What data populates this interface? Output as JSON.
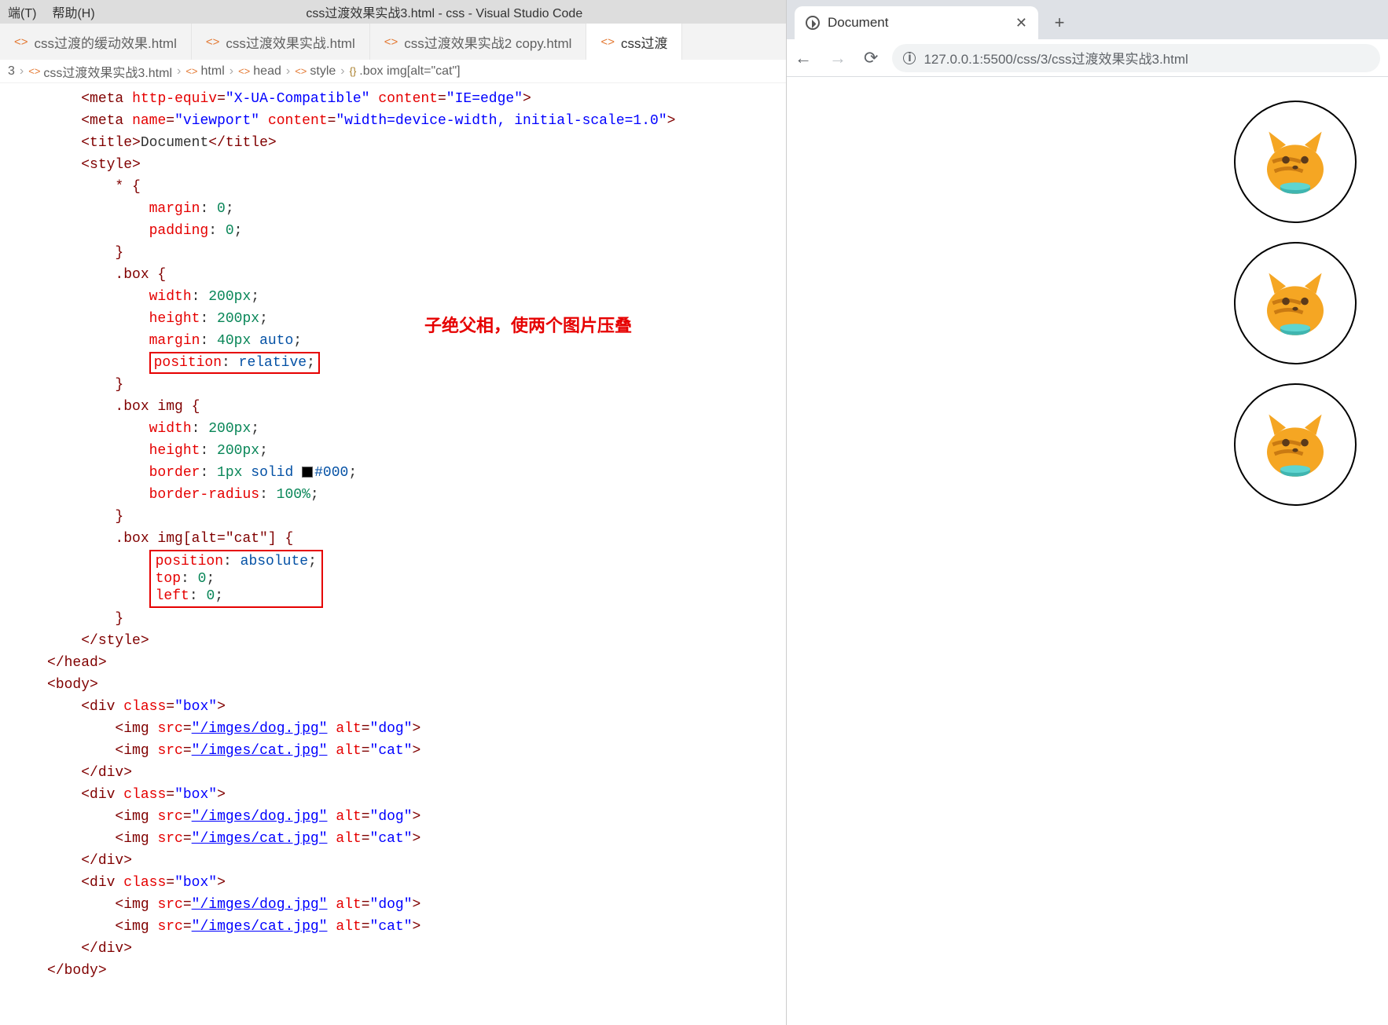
{
  "vscode": {
    "menubar": {
      "items": [
        "端(T)",
        "帮助(H)"
      ]
    },
    "title": "css过渡效果实战3.html - css - Visual Studio Code",
    "tabs": [
      {
        "label": "css过渡的缓动效果.html",
        "active": false
      },
      {
        "label": "css过渡效果实战.html",
        "active": false
      },
      {
        "label": "css过渡效果实战2 copy.html",
        "active": false
      },
      {
        "label": "css过渡",
        "active": true
      }
    ],
    "breadcrumb": [
      "3",
      "css过渡效果实战3.html",
      "html",
      "head",
      "style",
      ".box img[alt=\"cat\"]"
    ],
    "annotation": "子绝父相，使两个图片压叠",
    "code": {
      "meta1": {
        "tag": "meta",
        "a1": "http-equiv",
        "v1": "\"X-UA-Compatible\"",
        "a2": "content",
        "v2": "\"IE=edge\""
      },
      "meta2": {
        "tag": "meta",
        "a1": "name",
        "v1": "\"viewport\"",
        "a2": "content",
        "v2": "\"width=device-width, initial-scale=1.0\""
      },
      "title": {
        "open": "title",
        "text": "Document"
      },
      "style_open": "style",
      "r_star": {
        "sel": "* {",
        "p1": "margin",
        "v1": "0",
        "p2": "padding",
        "v2": "0",
        "close": "}"
      },
      "r_box": {
        "sel": ".box {",
        "p1": "width",
        "v1": "200px",
        "p2": "height",
        "v2": "200px",
        "p3": "margin",
        "v3a": "40px",
        "v3b": "auto",
        "p4": "position",
        "v4": "relative",
        "close": "}"
      },
      "r_boximg": {
        "sel": ".box img {",
        "p1": "width",
        "v1": "200px",
        "p2": "height",
        "v2": "200px",
        "p3": "border",
        "v3a": "1px",
        "v3b": "solid",
        "v3c": "#000",
        "p4": "border-radius",
        "v4": "100%",
        "close": "}"
      },
      "r_cat": {
        "sel": ".box img[alt=\"cat\"] {",
        "p1": "position",
        "v1": "absolute",
        "p2": "top",
        "v2": "0",
        "p3": "left",
        "v3": "0",
        "close": "}"
      },
      "style_close": "/style",
      "head_close": "/head",
      "body_open": "body",
      "divs": [
        {
          "open": "div",
          "cls": "\"box\"",
          "img1": {
            "src": "\"/imges/dog.jpg\"",
            "alt": "\"dog\""
          },
          "img2": {
            "src": "\"/imges/cat.jpg\"",
            "alt": "\"cat\""
          },
          "close": "/div"
        },
        {
          "open": "div",
          "cls": "\"box\"",
          "img1": {
            "src": "\"/imges/dog.jpg\"",
            "alt": "\"dog\""
          },
          "img2": {
            "src": "\"/imges/cat.jpg\"",
            "alt": "\"cat\""
          },
          "close": "/div"
        },
        {
          "open": "div",
          "cls": "\"box\"",
          "img1": {
            "src": "\"/imges/dog.jpg\"",
            "alt": "\"dog\""
          },
          "img2": {
            "src": "\"/imges/cat.jpg\"",
            "alt": "\"cat\""
          },
          "close": "/div"
        }
      ],
      "body_close": "/body"
    }
  },
  "browser": {
    "tab_title": "Document",
    "url": "127.0.0.1:5500/css/3/css过渡效果实战3.html"
  }
}
